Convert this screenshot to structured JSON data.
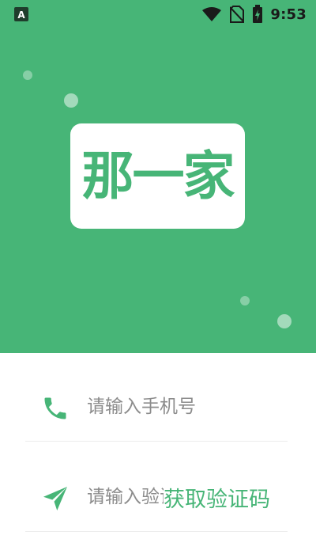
{
  "status_bar": {
    "app_icon": "a-letter-icon",
    "time": "9:53",
    "icons": [
      "wifi-icon",
      "no-sim-icon",
      "battery-charging-icon"
    ]
  },
  "colors": {
    "brand_green": "#47b577",
    "status_text": "#1a1a1a",
    "placeholder": "#8c8c8c",
    "divider": "#ececec"
  },
  "logo": {
    "text": "那一家"
  },
  "form": {
    "phone": {
      "icon": "phone-icon",
      "placeholder": "请输入手机号",
      "value": ""
    },
    "code": {
      "icon": "send-icon",
      "placeholder": "请输入验证码",
      "value": "",
      "button_label": "获取验证码"
    }
  }
}
